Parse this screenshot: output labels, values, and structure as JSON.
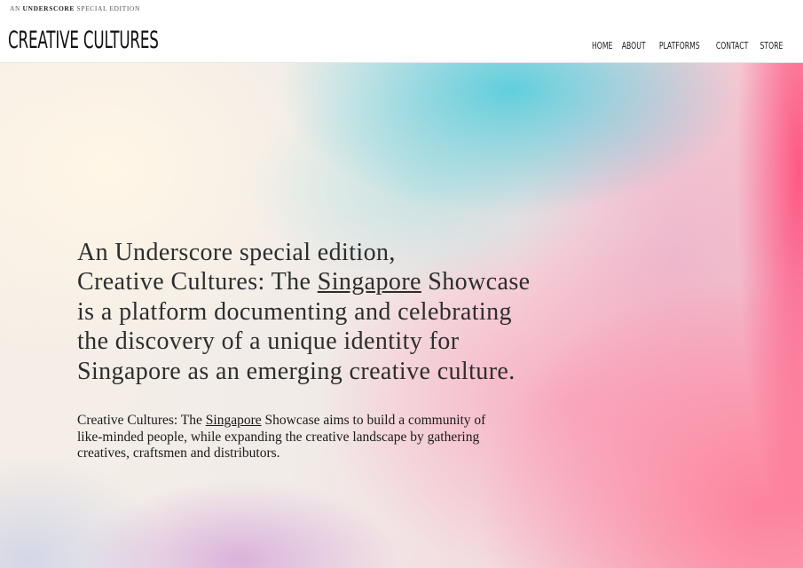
{
  "header": {
    "tagline_prefix": "An",
    "tagline_bold": "Underscore",
    "tagline_suffix": "Special Edition",
    "logo": "CREATIVE CULTURES"
  },
  "nav": {
    "items": [
      "HOME",
      "ABOUT",
      "PLATFORMS",
      "CONTACT",
      "STORE"
    ]
  },
  "hero": {
    "headline": {
      "line1": "An Underscore special edition,",
      "line2_before": "Creative Cultures: The ",
      "line2_link": "Singapore",
      "line2_after": " Showcase",
      "line3": "is a platform documenting and celebrating",
      "line4": "the discovery of a unique identity for",
      "line5": "Singapore as an emerging creative culture."
    },
    "body": {
      "line1_before": "Creative Cultures: The ",
      "line1_link": "Singapore",
      "line1_after": " Showcase aims to build a community of",
      "line2": "like-minded people, while expanding the creative landscape by gathering",
      "line3": "creatives, craftsmen and distributors."
    }
  }
}
